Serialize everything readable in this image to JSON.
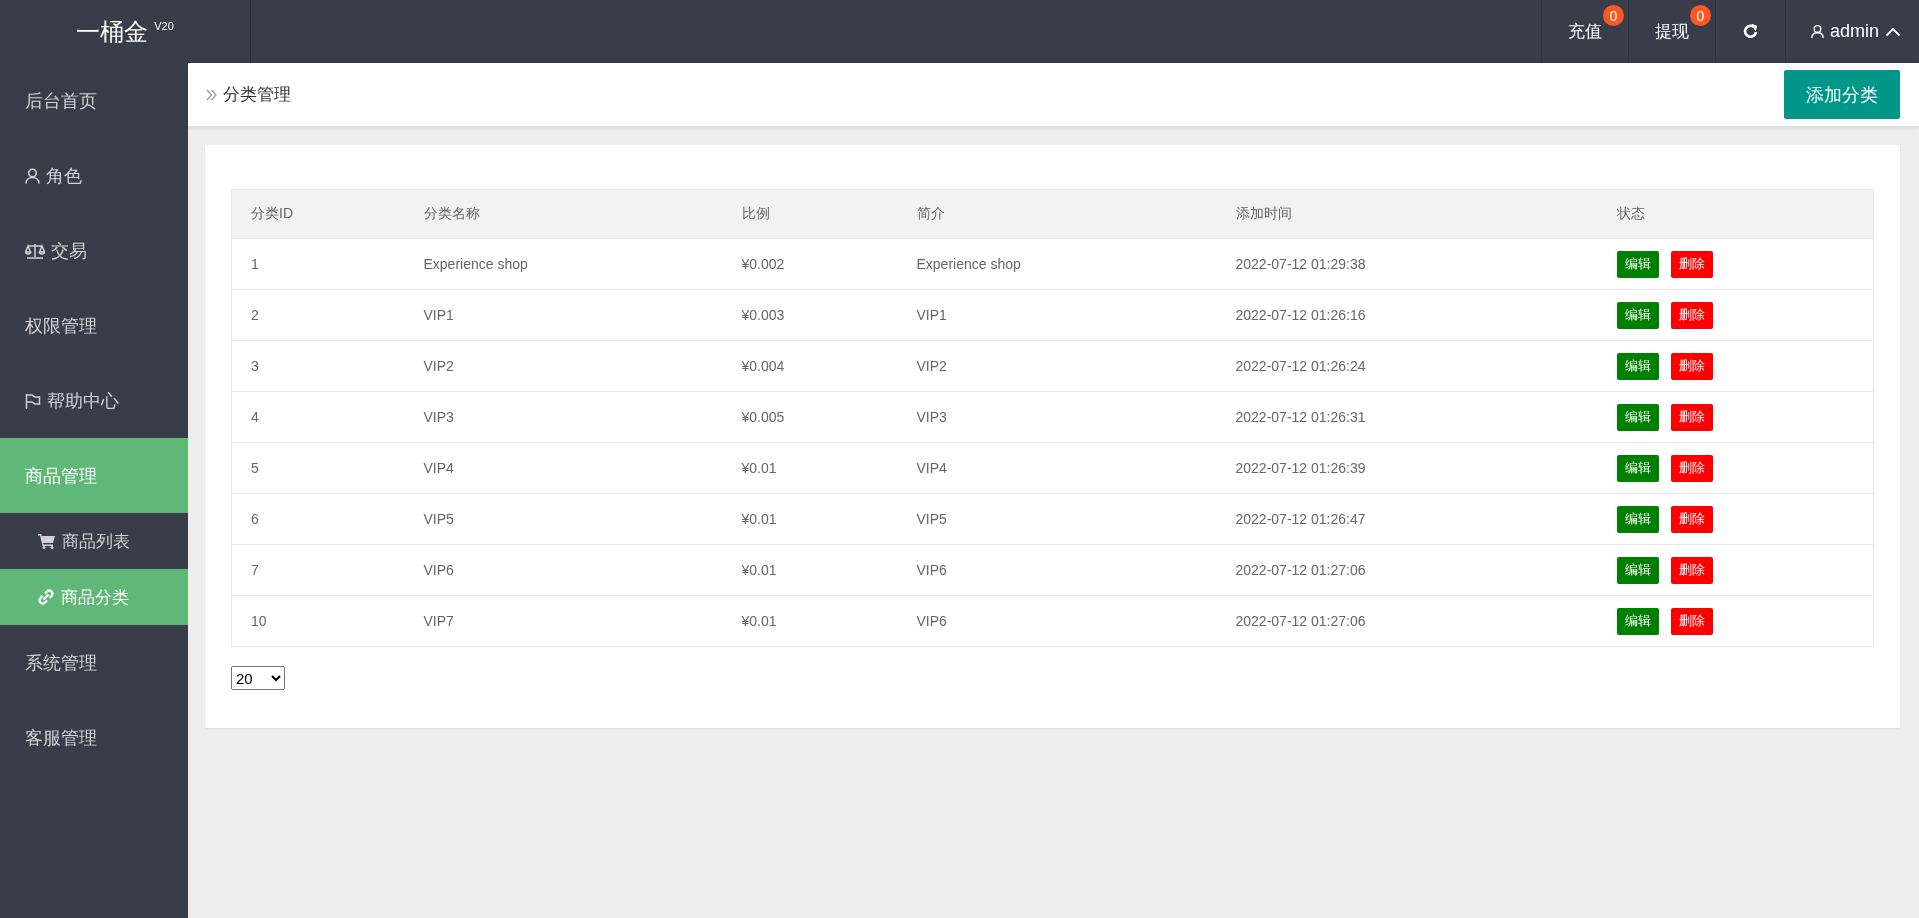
{
  "header": {
    "logo": "一桶金",
    "version": "V20",
    "actions": [
      {
        "label": "充值",
        "badge": "0"
      },
      {
        "label": "提现",
        "badge": "0"
      }
    ],
    "user": "admin"
  },
  "sidebar": {
    "items": [
      {
        "label": "后台首页",
        "selected": false
      },
      {
        "label": "角色",
        "selected": false
      },
      {
        "label": "交易",
        "selected": false
      },
      {
        "label": "权限管理",
        "selected": false
      },
      {
        "label": "帮助中心",
        "selected": false
      },
      {
        "label": "商品管理",
        "selected": true,
        "children": [
          {
            "label": "商品列表",
            "selected": false
          },
          {
            "label": "商品分类",
            "selected": true
          }
        ]
      },
      {
        "label": "系统管理",
        "selected": false
      },
      {
        "label": "客服管理",
        "selected": false
      }
    ]
  },
  "breadcrumb": "分类管理",
  "add_button": "添加分类",
  "table": {
    "columns": [
      "分类ID",
      "分类名称",
      "比例",
      "简介",
      "添加时间",
      "状态"
    ],
    "rows": [
      {
        "id": "1",
        "name": "Experience shop",
        "ratio": "¥0.002",
        "intro": "Experience shop",
        "time": "2022-07-12 01:29:38",
        "actions": [
          {
            "label": "编辑",
            "kind": "edit"
          },
          {
            "label": "删除",
            "kind": "delete"
          }
        ]
      },
      {
        "id": "2",
        "name": "VIP1",
        "ratio": "¥0.003",
        "intro": "VIP1",
        "time": "2022-07-12 01:26:16",
        "actions": [
          {
            "label": "编辑",
            "kind": "edit"
          },
          {
            "label": "删除",
            "kind": "delete"
          }
        ]
      },
      {
        "id": "3",
        "name": "VIP2",
        "ratio": "¥0.004",
        "intro": "VIP2",
        "time": "2022-07-12 01:26:24",
        "actions": [
          {
            "label": "编辑",
            "kind": "edit"
          },
          {
            "label": "删除",
            "kind": "delete"
          }
        ]
      },
      {
        "id": "4",
        "name": "VIP3",
        "ratio": "¥0.005",
        "intro": "VIP3",
        "time": "2022-07-12 01:26:31",
        "actions": [
          {
            "label": "编辑",
            "kind": "edit"
          },
          {
            "label": "删除",
            "kind": "delete"
          }
        ]
      },
      {
        "id": "5",
        "name": "VIP4",
        "ratio": "¥0.01",
        "intro": "VIP4",
        "time": "2022-07-12 01:26:39",
        "actions": [
          {
            "label": "编辑",
            "kind": "edit"
          },
          {
            "label": "删除",
            "kind": "delete"
          }
        ]
      },
      {
        "id": "6",
        "name": "VIP5",
        "ratio": "¥0.01",
        "intro": "VIP5",
        "time": "2022-07-12 01:26:47",
        "actions": [
          {
            "label": "编辑",
            "kind": "edit"
          },
          {
            "label": "删除",
            "kind": "delete"
          }
        ]
      },
      {
        "id": "7",
        "name": "VIP6",
        "ratio": "¥0.01",
        "intro": "VIP6",
        "time": "2022-07-12 01:27:06",
        "actions": [
          {
            "label": "编辑",
            "kind": "edit"
          },
          {
            "label": "删除",
            "kind": "delete"
          }
        ]
      },
      {
        "id": "10",
        "name": "VIP7",
        "ratio": "¥0.01",
        "intro": "VIP6",
        "time": "2022-07-12 01:27:06",
        "actions": [
          {
            "label": "编辑",
            "kind": "edit"
          },
          {
            "label": "删除",
            "kind": "delete"
          }
        ]
      }
    ]
  },
  "page_size": "20"
}
